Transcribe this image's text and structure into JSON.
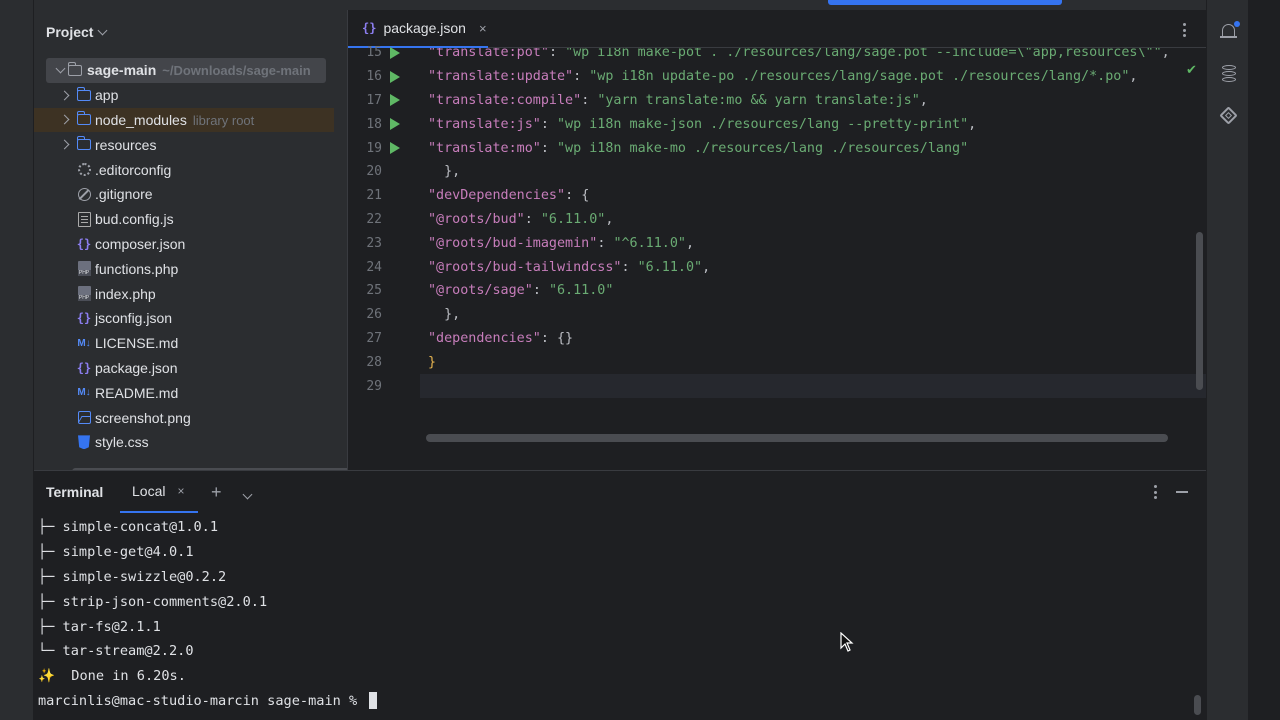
{
  "project": {
    "title": "Project",
    "root": {
      "name": "sage-main",
      "path": "~/Downloads/sage-main"
    },
    "items": [
      {
        "name": "app",
        "type": "folder",
        "expandable": true
      },
      {
        "name": "node_modules",
        "type": "folder-excluded",
        "expandable": true,
        "sub": "library root"
      },
      {
        "name": "resources",
        "type": "folder",
        "expandable": true
      },
      {
        "name": ".editorconfig",
        "type": "gear-icon"
      },
      {
        "name": ".gitignore",
        "type": "ignore-icon"
      },
      {
        "name": "bud.config.js",
        "type": "js-icon"
      },
      {
        "name": "composer.json",
        "type": "json-icon"
      },
      {
        "name": "functions.php",
        "type": "php-icon"
      },
      {
        "name": "index.php",
        "type": "php-icon"
      },
      {
        "name": "jsconfig.json",
        "type": "json-icon"
      },
      {
        "name": "LICENSE.md",
        "type": "markdown-icon"
      },
      {
        "name": "package.json",
        "type": "json-icon"
      },
      {
        "name": "README.md",
        "type": "markdown-icon"
      },
      {
        "name": "screenshot.png",
        "type": "image-icon"
      },
      {
        "name": "style.css",
        "type": "css-icon"
      }
    ]
  },
  "editor": {
    "tab": {
      "icon": "{}",
      "label": "package.json",
      "close": "×"
    },
    "lines": [
      {
        "num": "15",
        "run": true,
        "key": "translate:pot",
        "val": "wp i18n make-pot . ./resources/lang/sage.pot --include=\\\"app,resources\\\"",
        "indent": 4,
        "comma": true
      },
      {
        "num": "16",
        "run": true,
        "key": "translate:update",
        "val": "wp i18n update-po ./resources/lang/sage.pot ./resources/lang/*.po",
        "indent": 4,
        "comma": true
      },
      {
        "num": "17",
        "run": true,
        "key": "translate:compile",
        "val": "yarn translate:mo && yarn translate:js",
        "indent": 4,
        "comma": true
      },
      {
        "num": "18",
        "run": true,
        "key": "translate:js",
        "val": "wp i18n make-json ./resources/lang --pretty-print",
        "indent": 4,
        "comma": true
      },
      {
        "num": "19",
        "run": true,
        "key": "translate:mo",
        "val": "wp i18n make-mo ./resources/lang ./resources/lang",
        "indent": 4,
        "comma": false
      },
      {
        "num": "20",
        "raw": "  },"
      },
      {
        "num": "21",
        "key": "devDependencies",
        "open": "{",
        "indent": 2
      },
      {
        "num": "22",
        "key": "@roots/bud",
        "val": "6.11.0",
        "indent": 4,
        "comma": true
      },
      {
        "num": "23",
        "key": "@roots/bud-imagemin",
        "val": "^6.11.0",
        "indent": 4,
        "comma": true
      },
      {
        "num": "24",
        "key": "@roots/bud-tailwindcss",
        "val": "6.11.0",
        "indent": 4,
        "comma": true
      },
      {
        "num": "25",
        "key": "@roots/sage",
        "val": "6.11.0",
        "indent": 4,
        "comma": false
      },
      {
        "num": "26",
        "raw": "  },"
      },
      {
        "num": "27",
        "key": "dependencies",
        "open": "{}",
        "indent": 2
      },
      {
        "num": "28",
        "raw": "}",
        "brace": true
      },
      {
        "num": "29",
        "raw": ""
      }
    ]
  },
  "terminal": {
    "title": "Terminal",
    "tab": "Local",
    "close": "×",
    "plus": "+",
    "lines": [
      "├─ simple-concat@1.0.1",
      "├─ simple-get@4.0.1",
      "├─ simple-swizzle@0.2.2",
      "├─ strip-json-comments@2.0.1",
      "├─ tar-fs@2.1.1",
      "└─ tar-stream@2.2.0",
      "✨  Done in 6.20s."
    ],
    "prompt": "marcinlis@mac-studio-marcin sage-main % "
  }
}
